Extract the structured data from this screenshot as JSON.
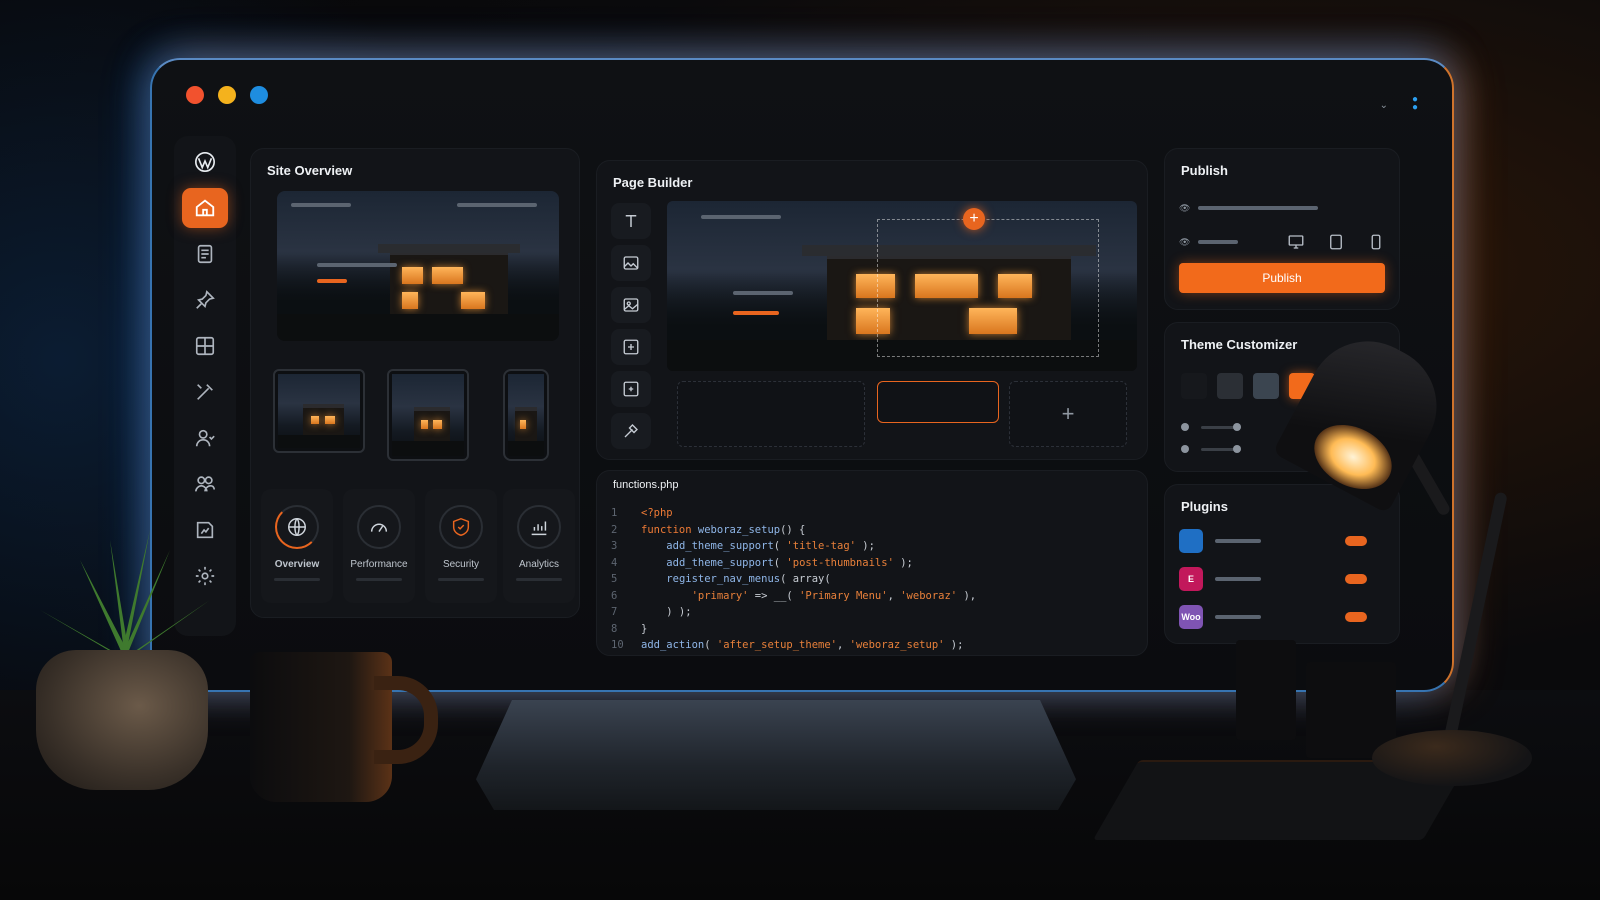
{
  "site_overview": {
    "title": "Site Overview"
  },
  "stats": [
    {
      "label": "Overview",
      "icon": "globe-icon"
    },
    {
      "label": "Performance",
      "icon": "speedometer-icon"
    },
    {
      "label": "Security",
      "icon": "shield-icon"
    },
    {
      "label": "Analytics",
      "icon": "chart-icon"
    }
  ],
  "page_builder": {
    "title": "Page Builder",
    "add_symbol": "+"
  },
  "code_editor": {
    "filename": "functions.php",
    "lines": [
      {
        "n": "1",
        "parts": [
          [
            "kw",
            "<?php"
          ]
        ]
      },
      {
        "n": "2",
        "parts": [
          [
            "kw",
            "function "
          ],
          [
            "fn",
            "weboraz_setup"
          ],
          [
            "tx",
            "() {"
          ]
        ]
      },
      {
        "n": "3",
        "parts": [
          [
            "tx",
            "    "
          ],
          [
            "fn",
            "add_theme_support"
          ],
          [
            "tx",
            "( "
          ],
          [
            "str",
            "'title-tag'"
          ],
          [
            "tx",
            " );"
          ]
        ]
      },
      {
        "n": "4",
        "parts": [
          [
            "tx",
            "    "
          ],
          [
            "fn",
            "add_theme_support"
          ],
          [
            "tx",
            "( "
          ],
          [
            "str",
            "'post-thumbnails'"
          ],
          [
            "tx",
            " );"
          ]
        ]
      },
      {
        "n": "5",
        "parts": [
          [
            "tx",
            "    "
          ],
          [
            "fn",
            "register_nav_menus"
          ],
          [
            "tx",
            "( array("
          ]
        ]
      },
      {
        "n": "6",
        "parts": [
          [
            "tx",
            "        "
          ],
          [
            "str",
            "'primary'"
          ],
          [
            "tx",
            " => __( "
          ],
          [
            "str",
            "'Primary Menu'"
          ],
          [
            "tx",
            ", "
          ],
          [
            "str",
            "'weboraz'"
          ],
          [
            "tx",
            " ),"
          ]
        ]
      },
      {
        "n": "7",
        "parts": [
          [
            "tx",
            "    ) );"
          ]
        ]
      },
      {
        "n": "8",
        "parts": [
          [
            "tx",
            "}"
          ]
        ]
      },
      {
        "n": "10",
        "parts": [
          [
            "fn",
            "add_action"
          ],
          [
            "tx",
            "( "
          ],
          [
            "str",
            "'after_setup_theme'"
          ],
          [
            "tx",
            ", "
          ],
          [
            "str",
            "'weboraz_setup'"
          ],
          [
            "tx",
            " );"
          ]
        ]
      }
    ]
  },
  "publish": {
    "title": "Publish",
    "button_label": "Publish"
  },
  "theme_customizer": {
    "title": "Theme Customizer",
    "swatches": [
      "#16181c",
      "#2b2f35",
      "#3b4550",
      "#f26a1b",
      "#1c1e22"
    ]
  },
  "plugins": {
    "title": "Plugins",
    "items": [
      {
        "logo_text": "",
        "color": "#1f6fc4"
      },
      {
        "logo_text": "E",
        "color": "#c2185b"
      },
      {
        "logo_text": "Woo",
        "color": "#7f54b3"
      }
    ]
  },
  "colors": {
    "accent": "#e8651f",
    "frame_blue": "#2c9ff0"
  }
}
